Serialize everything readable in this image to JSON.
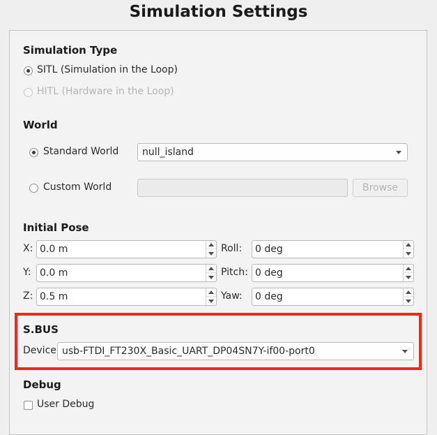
{
  "title": "Simulation Settings",
  "simulation_type": {
    "heading": "Simulation Type",
    "options": [
      {
        "label": "SITL (Simulation in the Loop)",
        "checked": true,
        "enabled": true
      },
      {
        "label": "HITL (Hardware in the Loop)",
        "checked": false,
        "enabled": false
      }
    ]
  },
  "world": {
    "heading": "World",
    "standard": {
      "label": "Standard World",
      "checked": true,
      "value": "null_island"
    },
    "custom": {
      "label": "Custom World",
      "checked": false,
      "value": "",
      "browse_label": "Browse"
    }
  },
  "initial_pose": {
    "heading": "Initial Pose",
    "fields": [
      {
        "label": "X:",
        "value": "0.0 m"
      },
      {
        "label": "Roll:",
        "value": "0 deg"
      },
      {
        "label": "Y:",
        "value": "0.0 m"
      },
      {
        "label": "Pitch:",
        "value": "0 deg"
      },
      {
        "label": "Z:",
        "value": "0.5 m"
      },
      {
        "label": "Yaw:",
        "value": "0 deg"
      }
    ]
  },
  "sbus": {
    "heading": "S.BUS",
    "device_label": "Device",
    "device_value": "usb-FTDI_FT230X_Basic_UART_DP04SN7Y-if00-port0",
    "highlight_color": "#ec2a1c"
  },
  "debug": {
    "heading": "Debug",
    "user_debug_label": "User Debug",
    "user_debug_checked": false
  }
}
